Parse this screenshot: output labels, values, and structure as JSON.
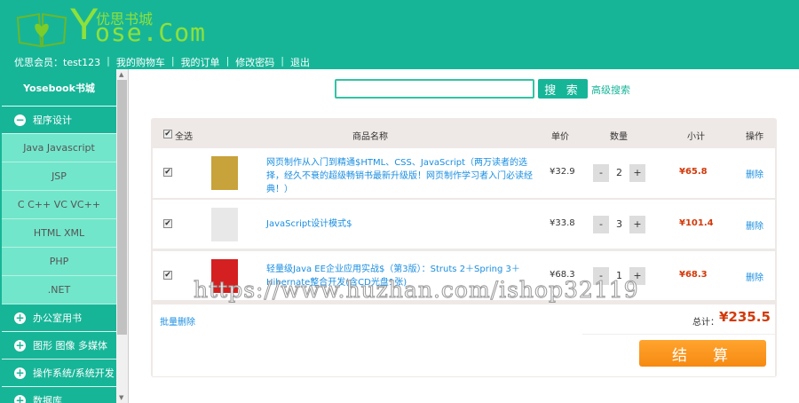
{
  "header": {
    "logo_cn": "优思书城",
    "logo_y": "Y",
    "logo_rest": "ose.Com",
    "nav": [
      "优思会员：test123",
      "我的购物车",
      "我的订单",
      "修改密码",
      "退出"
    ]
  },
  "sidebar": {
    "title": "Yosebook书城",
    "open_category": "程序设计",
    "sub_items": [
      "Java Javascript",
      "JSP",
      "C C++ VC VC++",
      "HTML XML",
      "PHP",
      ".NET"
    ],
    "categories": [
      "办公室用书",
      "图形 图像 多媒体",
      "操作系统/系统开发",
      "数据库"
    ]
  },
  "search": {
    "value": "",
    "button": "搜 索",
    "advanced": "高级搜索"
  },
  "cart": {
    "headers": {
      "select_all": "全选",
      "name": "商品名称",
      "price": "单价",
      "qty": "数量",
      "subtotal": "小计",
      "op": "操作"
    },
    "items": [
      {
        "name": "网页制作从入门到精通$HTML、CSS、JavaScript（两万读者的选择，经久不衰的超级畅销书最新升级版！网页制作学习者入门必读经典！）",
        "price": "¥32.9",
        "qty": "2",
        "subtotal": "¥65.8",
        "op": "删除",
        "checked": true,
        "cover": "#c8a23a"
      },
      {
        "name": "JavaScript设计模式$",
        "price": "¥33.8",
        "qty": "3",
        "subtotal": "¥101.4",
        "op": "删除",
        "checked": true,
        "cover": "#e8e8e8"
      },
      {
        "name": "轻量级Java EE企业应用实战$（第3版）：Struts 2＋Spring 3＋Hibernate整合开发(含CD光盘1张)",
        "price": "¥68.3",
        "qty": "1",
        "subtotal": "¥68.3",
        "op": "删除",
        "checked": true,
        "cover": "#d42020"
      }
    ],
    "batch_delete": "批量删除",
    "total_label": "总计：",
    "total": "¥235.5",
    "checkout": "结　算",
    "minus": "-",
    "plus": "+"
  },
  "watermark": "https://www.huzhan.com/ishop32119"
}
